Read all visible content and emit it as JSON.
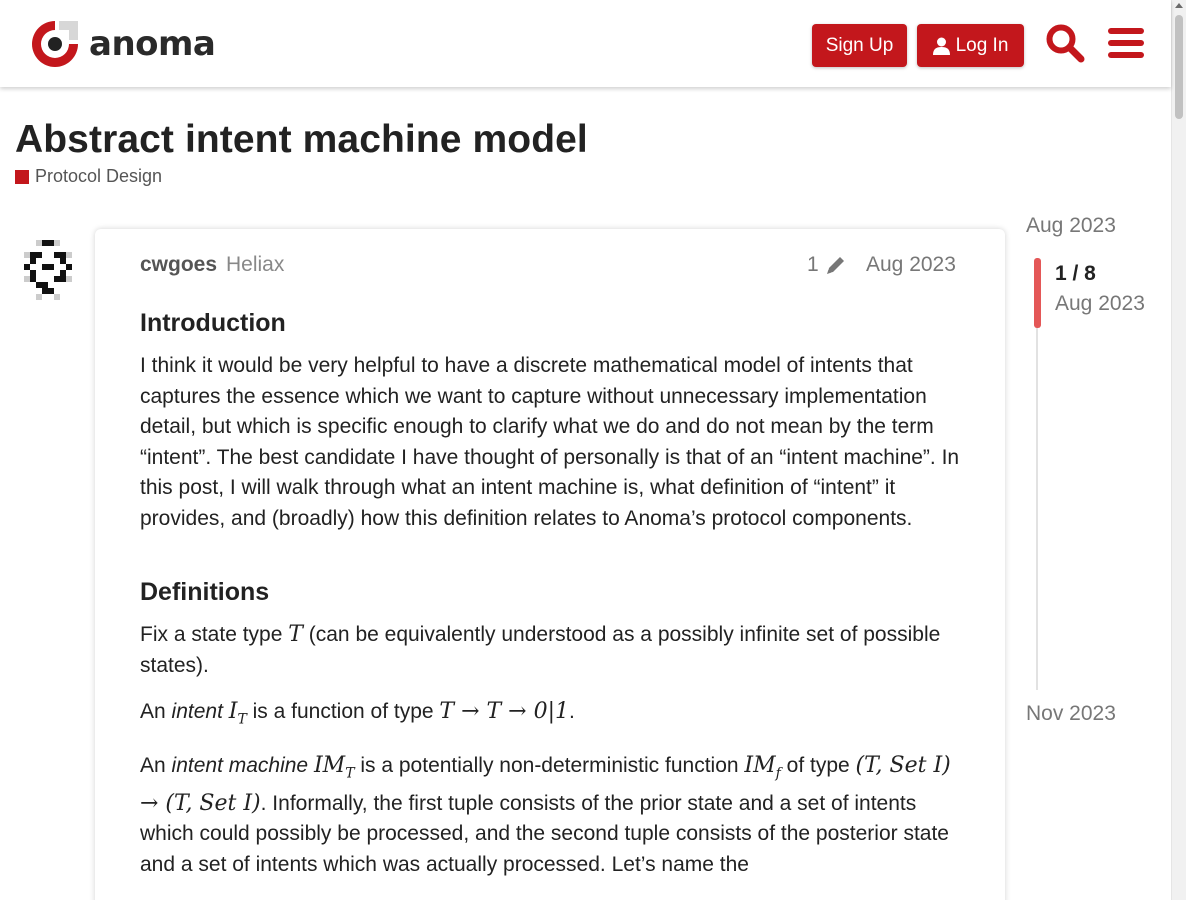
{
  "header": {
    "brand": "anoma",
    "signup_label": "Sign Up",
    "login_label": "Log In",
    "accent": "#c3171c"
  },
  "topic": {
    "title": "Abstract intent machine model",
    "category": "Protocol Design"
  },
  "post": {
    "author": "cwgoes",
    "group": "Heliax",
    "edit_count": "1",
    "date": "Aug 2023",
    "sections": {
      "intro_heading": "Introduction",
      "intro_text": "I think it would be very helpful to have a discrete mathematical model of intents that captures the essence which we want to capture without unnecessary implementation detail, but which is specific enough to clarify what we do and do not mean by the term “intent”. The best candidate I have thought of personally is that of an “intent machine”. In this post, I will walk through what an intent machine is, what definition of “intent” it provides, and (broadly) how this definition relates to Anoma’s protocol components.",
      "defs_heading": "Definitions",
      "p1_a": "Fix a state type ",
      "p1_math": "T",
      "p1_b": " (can be equivalently understood as a possibly infinite set of possible states).",
      "p2_a": "An ",
      "p2_em": "intent",
      "p2_math": "I",
      "p2_sub": "T",
      "p2_b": " is a function of type ",
      "p2_type": "T → T → 0|1",
      "p2_c": ".",
      "p3_a": "An ",
      "p3_em": "intent machine",
      "p3_math": "IM",
      "p3_sub": "T",
      "p3_b": " is a potentially non-deterministic function ",
      "p3_math2": "IM",
      "p3_sub2": "f",
      "p3_c": " of type ",
      "p3_type": "(T, Set I) → (T, Set I)",
      "p3_d": ". Informally, the first tuple consists of the prior state and a set of intents which could possibly be processed, and the second tuple consists of the posterior state and a set of intents which was actually processed. Let’s name the"
    }
  },
  "timeline": {
    "start": "Aug 2023",
    "position": "1 / 8",
    "current_date": "Aug 2023",
    "end": "Nov 2023"
  }
}
